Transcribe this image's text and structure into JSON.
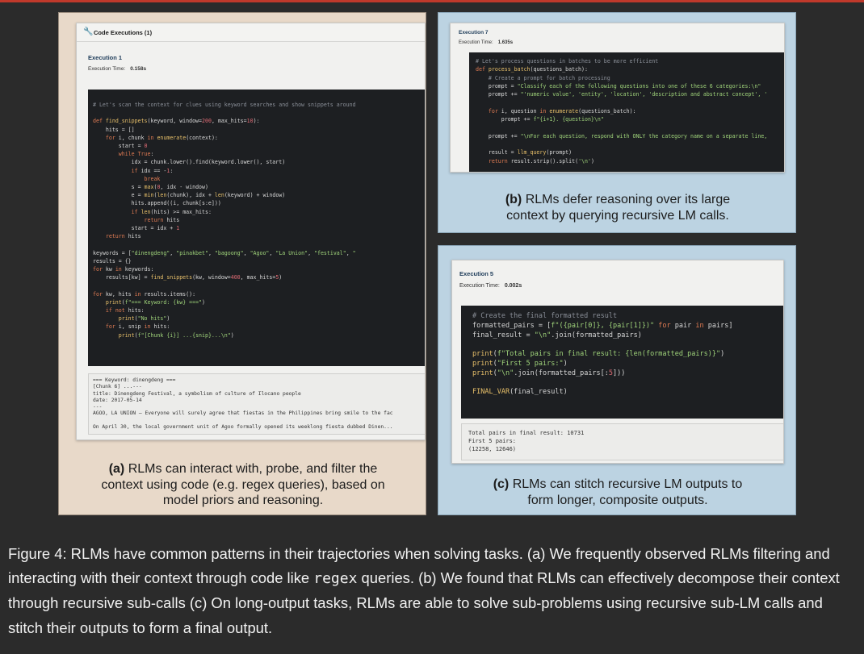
{
  "panel_a": {
    "window_title": "Code Executions (1)",
    "execution_label": "Execution 1",
    "time_label": "Execution Time:",
    "time_value": "0.158s",
    "code_lines": [
      "# Let's scan the context for clues using keyword searches and show snippets around",
      "",
      "def find_snippets(keyword, window=200, max_hits=10):",
      "    hits = []",
      "    for i, chunk in enumerate(context):",
      "        start = 0",
      "        while True:",
      "            idx = chunk.lower().find(keyword.lower(), start)",
      "            if idx == -1:",
      "                break",
      "            s = max(0, idx - window)",
      "            e = min(len(chunk), idx + len(keyword) + window)",
      "            hits.append((i, chunk[s:e]))",
      "            if len(hits) >= max_hits:",
      "                return hits",
      "            start = idx + 1",
      "    return hits",
      "",
      "keywords = [\"dinengdeng\", \"pinakbet\", \"bagoong\", \"Agoo\", \"La Union\", \"festival\", \"",
      "results = {}",
      "for kw in keywords:",
      "    results[kw] = find_snippets(kw, window=400, max_hits=5)",
      "",
      "for kw, hits in results.items():",
      "    print(f\"=== Keyword: {kw} ===\")",
      "    if not hits:",
      "        print(\"No hits\")",
      "    for i, snip in hits:",
      "        print(f\"[Chunk {i}] ...{snip}...\\n\")"
    ],
    "output_lines": [
      "=== Keyword: dinengdeng ===",
      "[Chunk 6] ...---",
      "title: Dinengdeng Festival, a symbolism of culture of Ilocano people",
      "date: 2017-05-14",
      "---",
      "AGOO, LA UNION – Everyone will surely agree that fiestas in the Philippines bring smile to the fac",
      "",
      "On April 30, the local government unit of Agoo formally opened its weeklong fiesta dubbed Dinen..."
    ],
    "caption_label": "(a)",
    "caption_lines": [
      "RLMs can interact with, probe, and filter the",
      "context using code (e.g. regex queries), based on",
      "model priors and reasoning."
    ]
  },
  "panel_b": {
    "execution_label": "Execution 7",
    "time_label": "Execution Time:",
    "time_value": "1.635s",
    "code_lines": [
      "# Let's process questions in batches to be more efficient",
      "def process_batch(questions_batch):",
      "    # Create a prompt for batch processing",
      "    prompt = \"Classify each of the following questions into one of these 6 categories:\\n\"",
      "    prompt += \"'numeric value', 'entity', 'location', 'description and abstract concept', '",
      "",
      "    for i, question in enumerate(questions_batch):",
      "        prompt += f\"{i+1}. {question}\\n\"",
      "",
      "    prompt += \"\\nFor each question, respond with ONLY the category name on a separate line,",
      "",
      "    result = llm_query(prompt)",
      "    return result.strip().split('\\n')"
    ],
    "caption_label": "(b)",
    "caption_lines": [
      "RLMs defer reasoning over its large",
      "context by querying recursive LM calls."
    ]
  },
  "panel_c": {
    "execution_label": "Execution 5",
    "time_label": "Execution Time:",
    "time_value": "0.002s",
    "code_lines": [
      "# Create the final formatted result",
      "formatted_pairs = [f\"({pair[0]}, {pair[1]})\" for pair in pairs]",
      "final_result = \"\\n\".join(formatted_pairs)",
      "",
      "print(f\"Total pairs in final result: {len(formatted_pairs)}\")",
      "print(\"First 5 pairs:\")",
      "print(\"\\n\".join(formatted_pairs[:5]))",
      "",
      "FINAL_VAR(final_result)"
    ],
    "output_lines": [
      "Total pairs in final result: 10731",
      "First 5 pairs:",
      "(12258, 12646)"
    ],
    "caption_label": "(c)",
    "caption_lines": [
      "RLMs can stitch recursive LM outputs to",
      "form longer, composite outputs."
    ]
  },
  "figure_caption": {
    "part1": "Figure 4: RLMs have common patterns in their trajectories when solving tasks. (a) We frequently observed RLMs filtering and interacting with their context through code like ",
    "code_word": "regex",
    "part2": " queries. (b) We found that RLMs can effectively decompose their context through recursive sub-calls (c) On long-output tasks, RLMs are able to solve sub-problems using recursive sub-LM calls and stitch their outputs to form a final output."
  },
  "colors": {
    "panel_a_bg": "#e8d9c9",
    "panel_bc_bg": "#bcd3e2",
    "page_bg": "#2b2b2b",
    "accent_bar": "#c0392b",
    "code_bg": "#1d1f22"
  }
}
